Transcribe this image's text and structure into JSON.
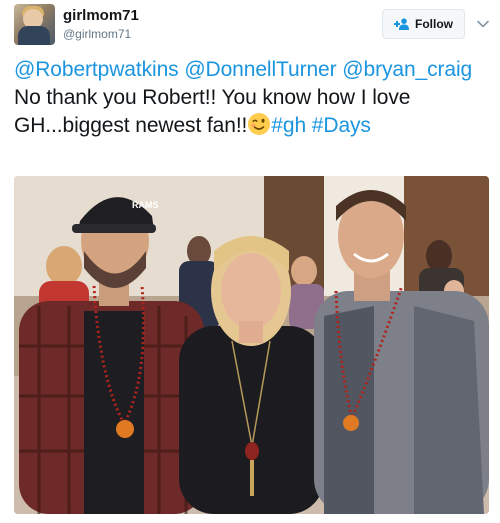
{
  "user": {
    "display_name": "girlmom71",
    "handle": "@girlmom71"
  },
  "follow_button": {
    "label": "Follow"
  },
  "tweet": {
    "mention_1": "@Robertpwatkins",
    "mention_2": "@DonnellTurner",
    "mention_3": "@bryan_craig",
    "body_text": " No thank you Robert!! You know how I love GH...biggest newest fan!!",
    "emoji": "winking-face-emoji",
    "hashtag_1": "#gh",
    "hashtag_2": "#Days"
  },
  "photo": {
    "subject": "three-people-wearing-pepper-necklaces",
    "cap_logo_text": "RAMS"
  },
  "icons": {
    "follow": "add-user-icon",
    "menu": "chevron-down-icon"
  },
  "colors": {
    "link": "#1b95e0",
    "text": "#14171a",
    "muted": "#657786",
    "button_bg": "#f5f8fa",
    "button_border": "#e1e8ed"
  }
}
